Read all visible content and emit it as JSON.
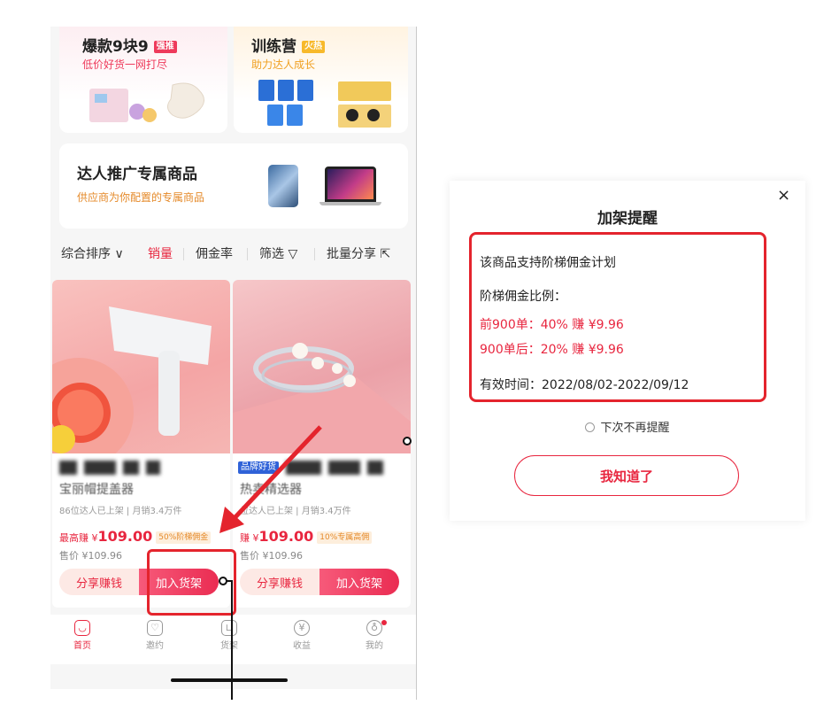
{
  "promo_left": {
    "title": "爆款9块9",
    "tag": "强推",
    "subtitle": "低价好货一网打尽"
  },
  "promo_right": {
    "title": "训练营",
    "tag": "火热",
    "subtitle": "助力达人成长"
  },
  "exclusive": {
    "title": "达人推广专属商品",
    "subtitle": "供应商为你配置的专属商品"
  },
  "sort_bar": {
    "comprehensive": "综合排序 ∨",
    "sales": "销量",
    "commission": "佣金率",
    "filter": "筛选 ▽",
    "batch_share": "批量分享 ⇱"
  },
  "products": [
    {
      "name": "宝丽帽提盖器",
      "brand": "",
      "stats": "86位达人已上架 | 月销3.4万件",
      "price_prefix": "最高赚 ¥",
      "price": "109.00",
      "price_tag": "50%阶梯佣金",
      "original": "售价 ¥109.96",
      "share_label": "分享赚钱",
      "add_label": "加入货架"
    },
    {
      "name": "热卖精选器",
      "brand": "品牌好货",
      "stats": "位达人已上架 | 月销3.4万件",
      "price_prefix": "赚 ¥",
      "price": "109.00",
      "price_tag": "10%专属高佣",
      "original": "售价 ¥109.96",
      "share_label": "分享赚钱",
      "add_label": "加入货架"
    }
  ],
  "tabs": [
    {
      "label": "首页",
      "icon": "home-icon",
      "glyph": "◡"
    },
    {
      "label": "邀约",
      "icon": "invite-icon",
      "glyph": "♡"
    },
    {
      "label": "货架",
      "icon": "shelf-icon",
      "glyph": "⊔"
    },
    {
      "label": "收益",
      "icon": "earnings-icon",
      "glyph": "¥"
    },
    {
      "label": "我的",
      "icon": "profile-icon",
      "glyph": "♁"
    }
  ],
  "dialog": {
    "close": "×",
    "title": "加架提醒",
    "line1": "该商品支持阶梯佣金计划",
    "line2": "阶梯佣金比例：",
    "tier1": "前900单：40%  赚 ¥9.96",
    "tier2": "900单后：20%  赚 ¥9.96",
    "validity": "有效时间：2022/08/02-2022/09/12",
    "no_remind": "下次不再提醒",
    "ok": "我知道了"
  },
  "colors": {
    "accent": "#e8263f",
    "annotation": "#e4242d",
    "orange": "#e58a2a"
  }
}
